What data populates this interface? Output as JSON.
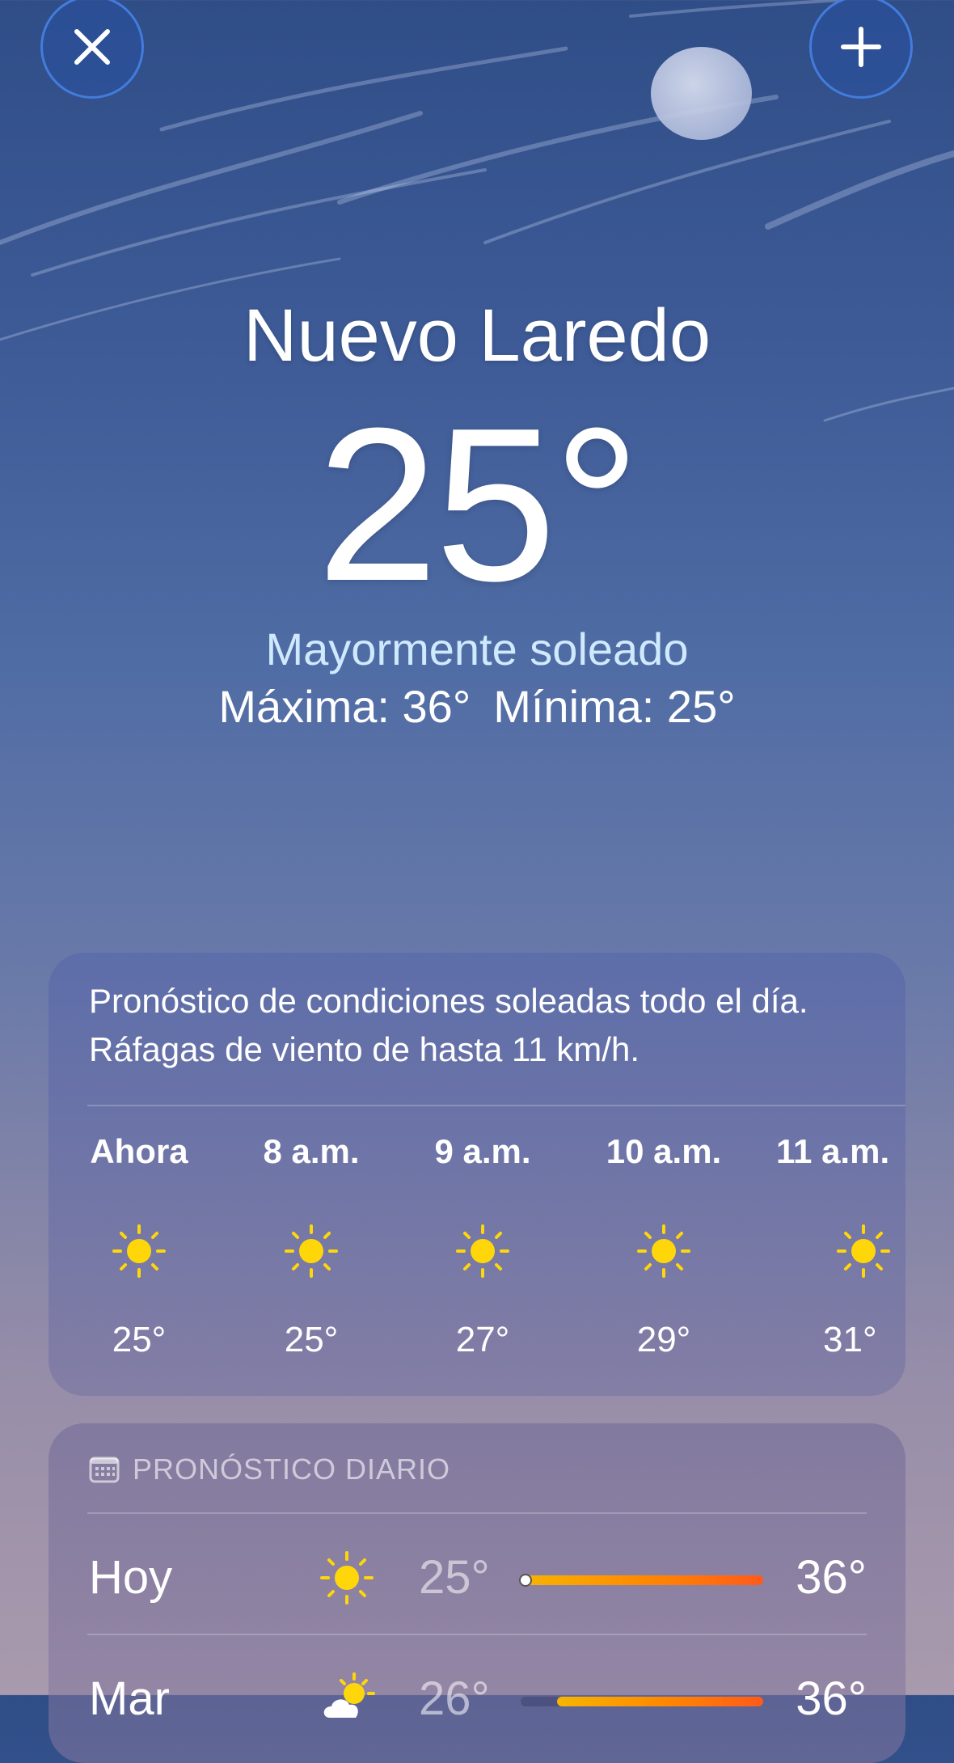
{
  "header": {
    "close_icon": "close-icon",
    "add_icon": "plus-icon"
  },
  "current": {
    "city": "Nuevo Laredo",
    "temperature": "25°",
    "condition": "Mayormente soleado",
    "high": "Máxima: 36°",
    "low": "Mínima: 25°"
  },
  "hourly": {
    "summary": "Pronóstico de condiciones soleadas todo el día. Ráfagas de viento de hasta 11 km/h.",
    "hours": [
      {
        "label": "Ahora",
        "icon": "sun-icon",
        "temp": "25°"
      },
      {
        "label": "8 a.m.",
        "icon": "sun-icon",
        "temp": "25°"
      },
      {
        "label": "9 a.m.",
        "icon": "sun-icon",
        "temp": "27°"
      },
      {
        "label": "10 a.m.",
        "icon": "sun-icon",
        "temp": "29°"
      },
      {
        "label": "11 a.m.",
        "icon": "sun-icon",
        "temp": "31°"
      }
    ]
  },
  "daily": {
    "header": "PRONÓSTICO DIARIO",
    "header_icon": "calendar-icon",
    "days": [
      {
        "name": "Hoy",
        "icon": "sun-icon",
        "low": "25°",
        "high": "36°",
        "range_start": 0.0,
        "range_end": 1.0,
        "current_marker": 0.0
      },
      {
        "name": "Mar",
        "icon": "partly-cloudy-icon",
        "low": "26°",
        "high": "36°",
        "range_start": 0.15,
        "range_end": 1.0
      }
    ]
  },
  "colors": {
    "sun": "#ffd60a",
    "condition_text": "#cfe9ff",
    "button_ring": "#4682e6"
  }
}
